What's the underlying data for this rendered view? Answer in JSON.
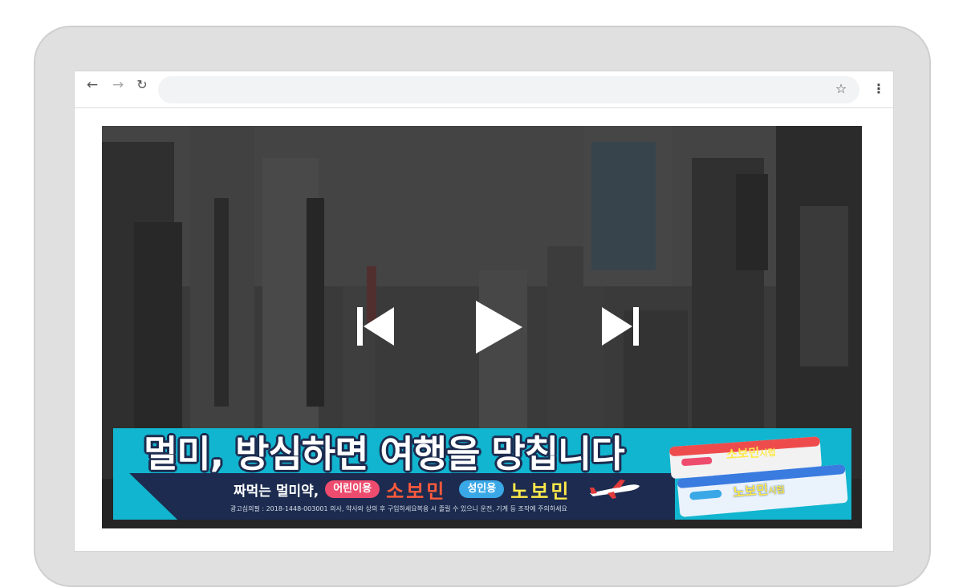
{
  "browser": {
    "back_icon": "arrow-left-icon",
    "forward_icon": "arrow-right-icon",
    "reload_icon": "reload-icon",
    "address_value": "",
    "star_icon": "star-icon",
    "menu_icon": "more-vertical-icon"
  },
  "video": {
    "controls": [
      "skip-previous-icon",
      "play-icon",
      "skip-next-icon"
    ]
  },
  "ad": {
    "headline": "멀미, 방심하면 여행을 망칩니다",
    "tagline": "짜먹는 멀미약,",
    "kids_label": "어린이용",
    "kids_brand": "소보민",
    "adult_label": "성인용",
    "adult_brand": "노보민",
    "disclaimer": "광고심의필 : 2018-1448-003001   의사, 약사와 상의 후 구입하세요복용 시 졸릴 수 있으니 운전, 기계 등 조작에 주의하세요",
    "pack_top_brand": "소보민",
    "pack_top_suffix": "시럽",
    "pack_bottom_brand": "노보민",
    "pack_bottom_suffix": "시럽",
    "colors": {
      "teal": "#11b5cf",
      "navy": "#1c2b4f",
      "red": "#ff5a3c",
      "yellow": "#ffe94a"
    }
  }
}
